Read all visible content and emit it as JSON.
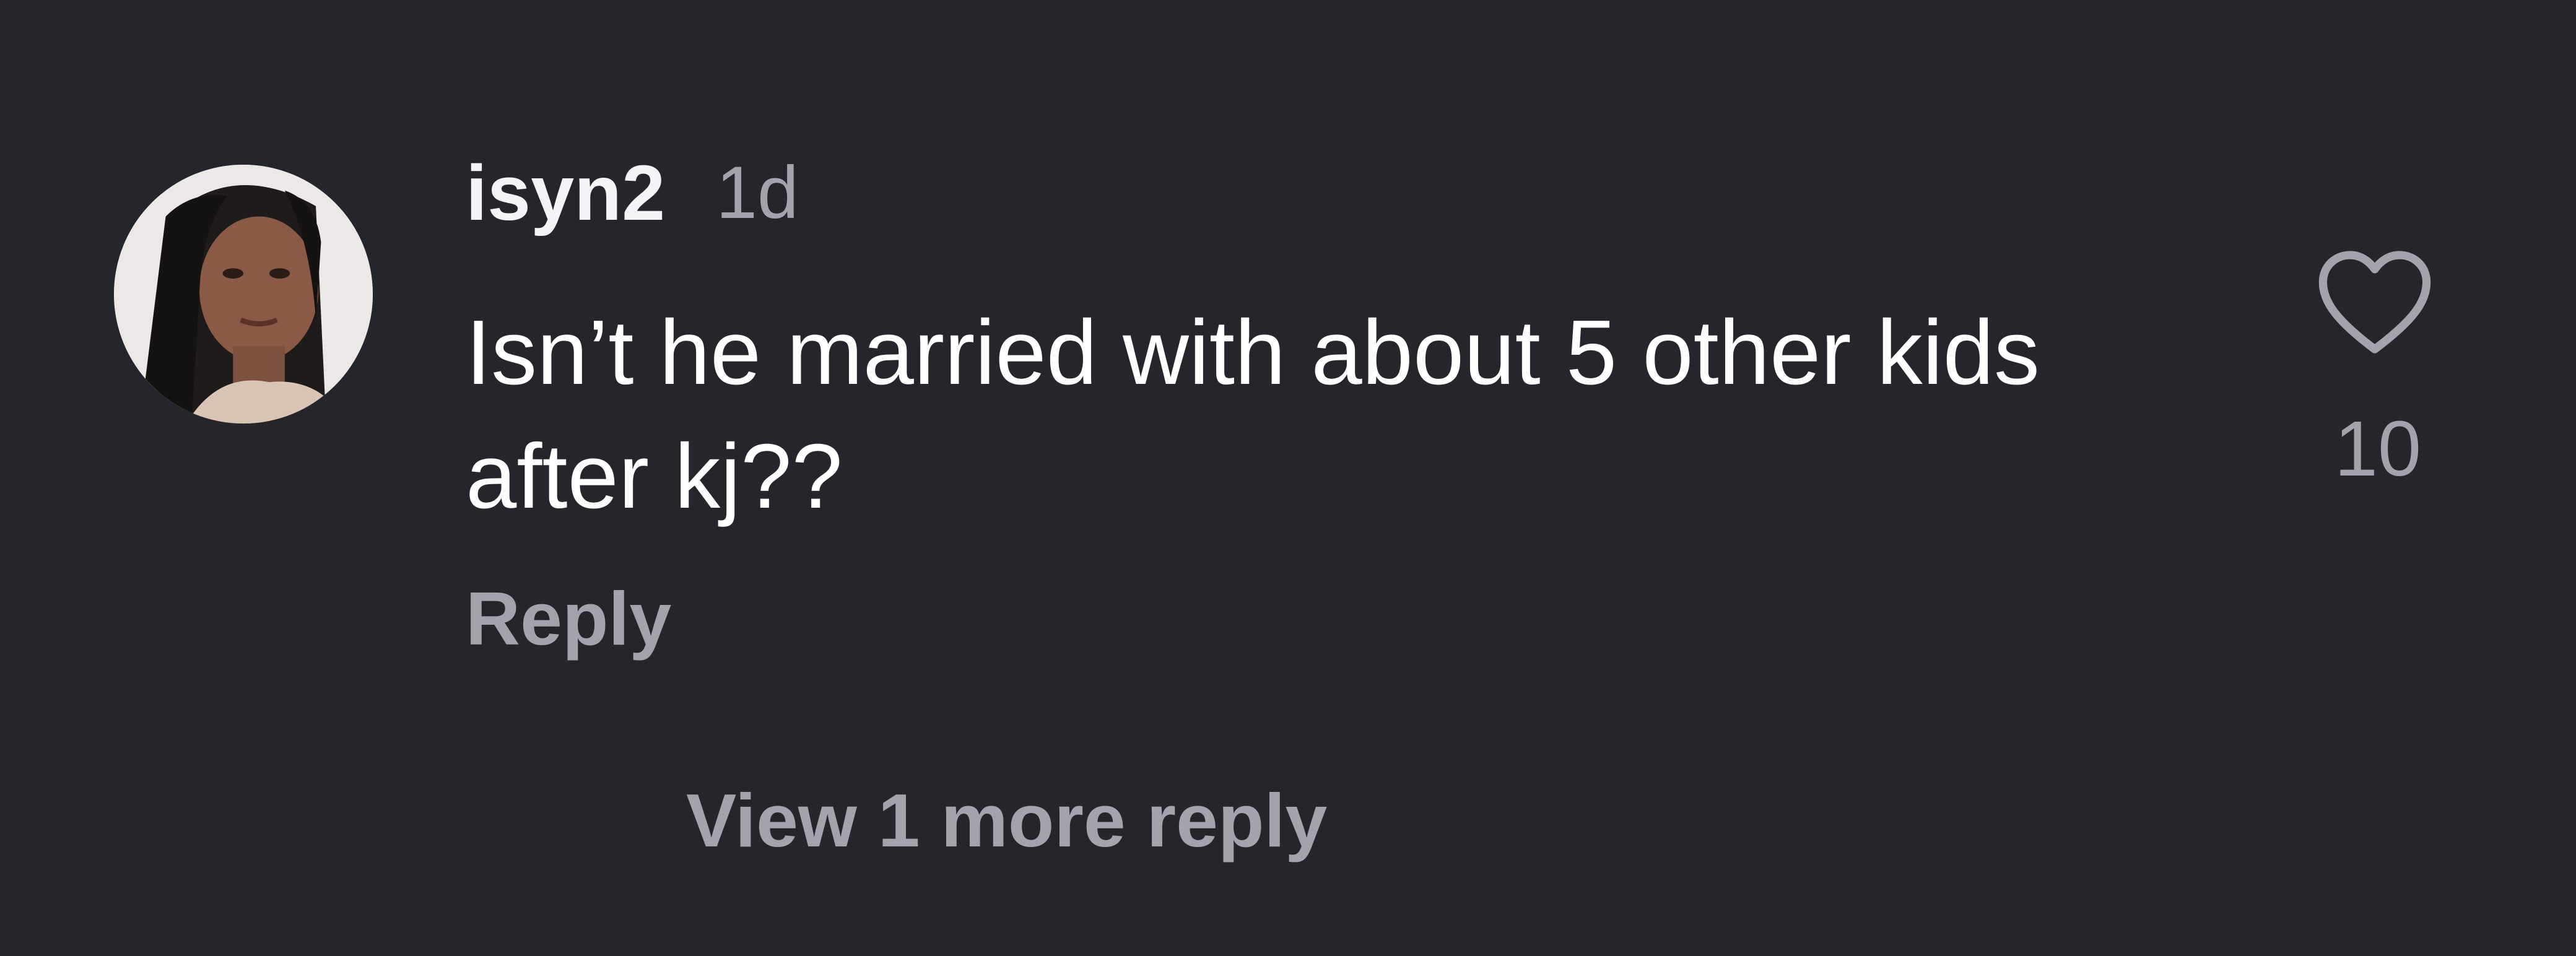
{
  "comment": {
    "username": "isyn2",
    "time": "1d",
    "text": "Isn’t he married with about 5 other kids after kj??",
    "reply_label": "Reply",
    "like_count": "10",
    "like_icon": "heart-outline-icon",
    "view_more_label": "View 1 more reply"
  },
  "colors": {
    "background": "#25262b",
    "primary_text": "#ffffff",
    "secondary_text": "#a3a4ab"
  }
}
